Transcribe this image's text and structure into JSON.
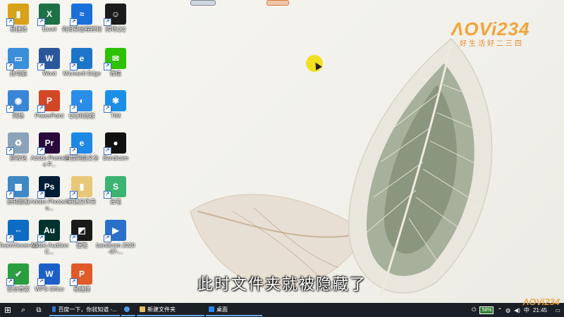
{
  "desktop_icons": [
    {
      "label": "易捷播",
      "color": "#d8a21a",
      "glyph": "▮",
      "icon": "folder-icon"
    },
    {
      "label": "Excel",
      "color": "#1e7145",
      "glyph": "X",
      "icon": "excel-icon"
    },
    {
      "label": "向日葵远程控制",
      "color": "#1a6fd8",
      "glyph": "≈",
      "icon": "sunflower-remote-icon"
    },
    {
      "label": "腾讯QQ",
      "color": "#1b1b1b",
      "glyph": "☺",
      "icon": "qq-icon"
    },
    {
      "label": "此电脑",
      "color": "#3b8fd8",
      "glyph": "▭",
      "icon": "this-pc-icon"
    },
    {
      "label": "Word",
      "color": "#2b579a",
      "glyph": "W",
      "icon": "word-icon"
    },
    {
      "label": "Microsoft Edge",
      "color": "#1c75c9",
      "glyph": "e",
      "icon": "edge-icon"
    },
    {
      "label": "微信",
      "color": "#2dc100",
      "glyph": "✉",
      "icon": "wechat-icon"
    },
    {
      "label": "网络",
      "color": "#3a86d6",
      "glyph": "◉",
      "icon": "network-icon"
    },
    {
      "label": "PowerPoint",
      "color": "#d24726",
      "glyph": "P",
      "icon": "powerpoint-icon"
    },
    {
      "label": "QQ浏览器",
      "color": "#2a8ee8",
      "glyph": "◐",
      "icon": "qq-browser-icon"
    },
    {
      "label": "TIM",
      "color": "#1a8fe6",
      "glyph": "✱",
      "icon": "tim-icon"
    },
    {
      "label": "回收站",
      "color": "#8aa3b8",
      "glyph": "♻",
      "icon": "recycle-bin-icon"
    },
    {
      "label": "Adobe Premiere P...",
      "color": "#2a0a3b",
      "glyph": "Pr",
      "icon": "premiere-icon"
    },
    {
      "label": "百度网盘文全",
      "color": "#1e88e5",
      "glyph": "e",
      "icon": "ie-icon"
    },
    {
      "label": "Bandicam",
      "color": "#111111",
      "glyph": "●",
      "icon": "bandicam-icon"
    },
    {
      "label": "控制面板",
      "color": "#3f88c5",
      "glyph": "▦",
      "icon": "control-panel-icon"
    },
    {
      "label": "Adobe Photosho...",
      "color": "#001d34",
      "glyph": "Ps",
      "icon": "photoshop-icon"
    },
    {
      "label": "新建文件夹",
      "color": "#e8c878",
      "glyph": "▮",
      "icon": "new-folder-icon"
    },
    {
      "label": "云笔",
      "color": "#3cb371",
      "glyph": "S",
      "icon": "notes-icon"
    },
    {
      "label": "TeamViewer 13",
      "color": "#0e6cc4",
      "glyph": "⇔",
      "icon": "teamviewer-icon"
    },
    {
      "label": "Adobe Audition C...",
      "color": "#00332e",
      "glyph": "Au",
      "icon": "audition-icon"
    },
    {
      "label": "便笺",
      "color": "#1a1a1a",
      "glyph": "◩",
      "icon": "sticky-notes-icon"
    },
    {
      "label": "bandicam 2020-07-...",
      "color": "#2a6fc9",
      "glyph": "▶",
      "icon": "video-file-icon"
    },
    {
      "label": "安全管家",
      "color": "#2a9d3f",
      "glyph": "✔",
      "icon": "security-icon"
    },
    {
      "label": "WPS Office",
      "color": "#1d5fc9",
      "glyph": "W",
      "icon": "wps-icon"
    },
    {
      "label": "易捷播",
      "color": "#e05a2a",
      "glyph": "P",
      "icon": "document-icon"
    }
  ],
  "logo": {
    "brand": "ɅOVi234",
    "tagline": "好生活好二三四"
  },
  "subtitle": "此时文件夹就被隐藏了",
  "watermark": "ɅOVi234",
  "taskbar": {
    "start_glyph": "⊞",
    "search_glyph": "⌕",
    "taskview_glyph": "⧉",
    "tasks": [
      {
        "label": "百度一下，你就知道 -...",
        "color": "#2a79d8"
      },
      {
        "label": "",
        "color": "#4a9ae6"
      },
      {
        "label": "新建文件夹",
        "color": "#e8c060"
      },
      {
        "label": "桌面",
        "color": "#2a88e6"
      }
    ],
    "battery": "58%",
    "ime": "中",
    "clock": "21:45"
  }
}
